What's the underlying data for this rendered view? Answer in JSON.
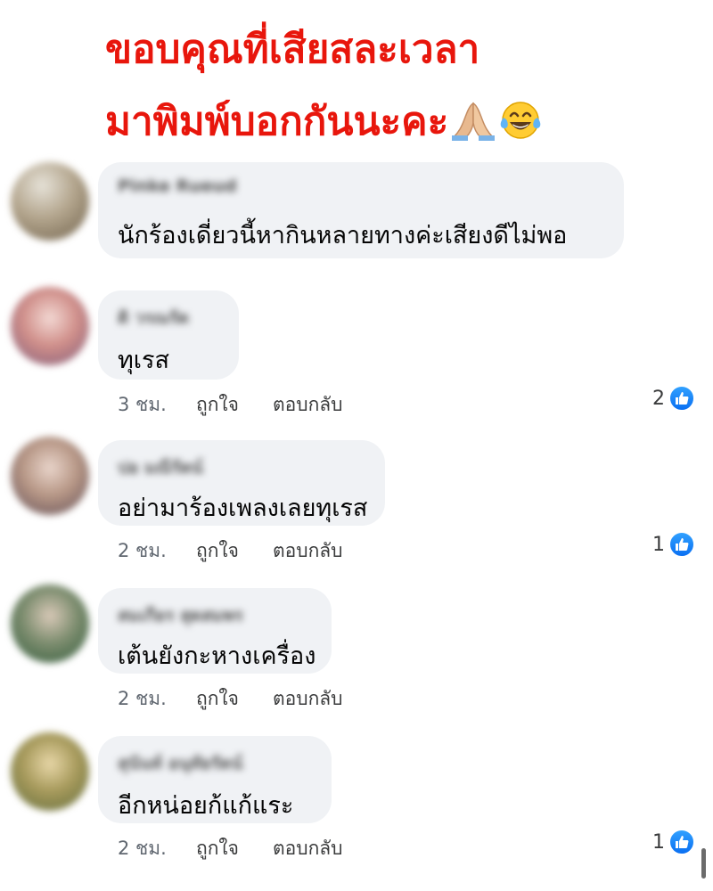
{
  "headline": {
    "line1": "ขอบคุณที่เสียสละเวลา",
    "line2": "มาพิมพ์บอกกันนะคะ"
  },
  "comments": [
    {
      "author": "Pinke Rueud",
      "text": "นักร้องเดี่ยวนี้หากินหลายทางค่ะเสียงดีไม่พอ",
      "time": "",
      "like_label": "",
      "reply_label": "",
      "reactions": ""
    },
    {
      "author": "ดิ วรณรัต",
      "text": "ทุเรส",
      "time": "3 ชม.",
      "like_label": "ถูกใจ",
      "reply_label": "ตอบกลับ",
      "reactions": "2"
    },
    {
      "author": "ปอ มณีรัตน์",
      "text": "อย่ามาร้องเพลงเลยทุเรส",
      "time": "2 ชม.",
      "like_label": "ถูกใจ",
      "reply_label": "ตอบกลับ",
      "reactions": "1"
    },
    {
      "author": "สมเกียร สุดสมพร",
      "text": "เต้นยังกะหางเครื่อง",
      "time": "2 ชม.",
      "like_label": "ถูกใจ",
      "reply_label": "ตอบกลับ",
      "reactions": ""
    },
    {
      "author": "สุนันท์ อนุทัยรัตน์",
      "text": "อีกหน่อยก้แก้แระ",
      "time": "2 ชม.",
      "like_label": "ถูกใจ",
      "reply_label": "ตอบกลับ",
      "reactions": "1"
    }
  ],
  "colors": {
    "headline": "#e8160c",
    "bubble": "#f0f2f5",
    "like_badge": "#1877f2"
  },
  "icons": {
    "pray": "folded-hands-emoji",
    "laugh": "tears-of-joy-emoji",
    "like": "thumbs-up-icon"
  }
}
